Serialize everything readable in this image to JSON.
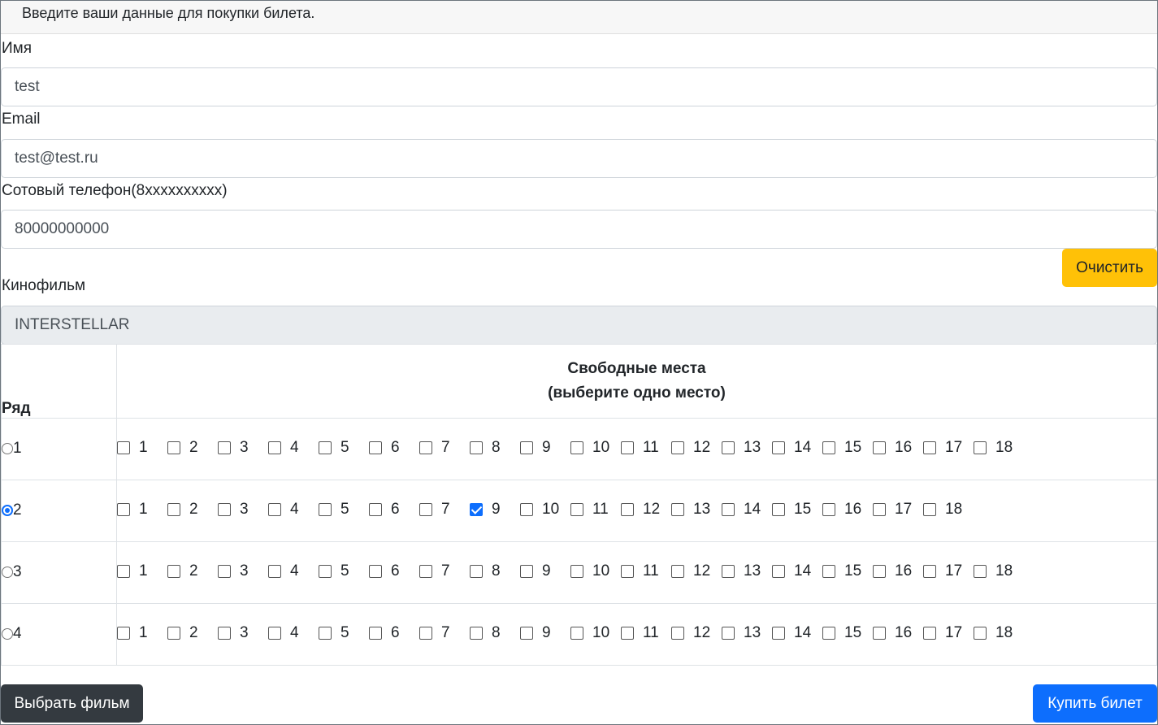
{
  "header": {
    "text": "Введите ваши данные для покупки билета."
  },
  "form": {
    "name_label": "Имя",
    "name_value": "test",
    "email_label": "Email",
    "email_value": "test@test.ru",
    "phone_label": "Сотовый телефон(8xxxxxxxxxx)",
    "phone_value": "80000000000",
    "clear_button": "Очистить",
    "movie_label": "Кинофильм",
    "movie_value": "INTERSTELLAR"
  },
  "table": {
    "row_header": "Ряд",
    "seats_header_line1": "Свободные места",
    "seats_header_line2": "(выберите одно место)",
    "rows": [
      {
        "row": "1",
        "selected": false,
        "seats": [
          "1",
          "2",
          "3",
          "4",
          "5",
          "6",
          "7",
          "8",
          "9",
          "10",
          "11",
          "12",
          "13",
          "14",
          "15",
          "16",
          "17",
          "18"
        ],
        "checked_seat": null
      },
      {
        "row": "2",
        "selected": true,
        "seats": [
          "1",
          "2",
          "3",
          "4",
          "5",
          "6",
          "7",
          "9",
          "10",
          "11",
          "12",
          "13",
          "14",
          "15",
          "16",
          "17",
          "18"
        ],
        "checked_seat": "9"
      },
      {
        "row": "3",
        "selected": false,
        "seats": [
          "1",
          "2",
          "3",
          "4",
          "5",
          "6",
          "7",
          "8",
          "9",
          "10",
          "11",
          "12",
          "13",
          "14",
          "15",
          "16",
          "17",
          "18"
        ],
        "checked_seat": null
      },
      {
        "row": "4",
        "selected": false,
        "seats": [
          "1",
          "2",
          "3",
          "4",
          "5",
          "6",
          "7",
          "8",
          "9",
          "10",
          "11",
          "12",
          "13",
          "14",
          "15",
          "16",
          "17",
          "18"
        ],
        "checked_seat": null
      }
    ]
  },
  "buttons": {
    "choose_movie": "Выбрать фильм",
    "buy_ticket": "Купить билет"
  },
  "colors": {
    "primary": "#0d6efd",
    "warning": "#ffc107",
    "dark": "#343a40"
  }
}
